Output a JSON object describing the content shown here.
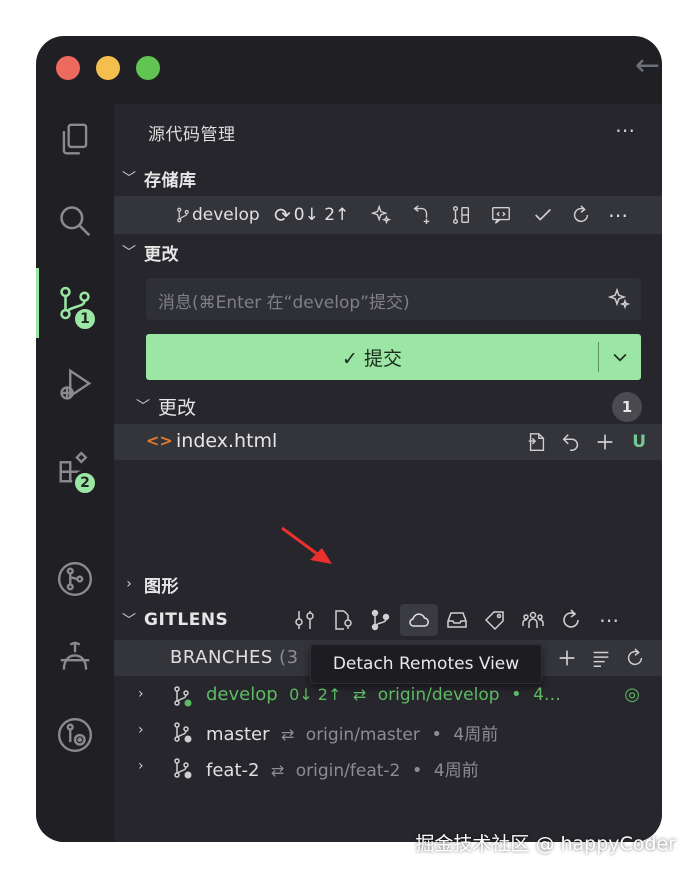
{
  "sidebar": {
    "title": "源代码管理",
    "repositories_label": "存储库",
    "branch": "develop",
    "sync": "0↓ 2↑",
    "changes_label": "更改",
    "commit_placeholder": "消息(⌘Enter 在“develop”提交)",
    "commit_label": "✓ 提交",
    "changes_sub_label": "更改",
    "changes_count": "1",
    "file_icon": "<>",
    "file_name": "index.html",
    "file_status": "U",
    "graph_label": "图形",
    "gitlens_label": "GITLENS",
    "branches_label": "BRANCHES",
    "branches_count_partial": "(3",
    "tooltip": "Detach Remotes View"
  },
  "activity": {
    "scm_badge": "1",
    "extensions_badge": "2"
  },
  "branches": [
    {
      "name": "develop",
      "sync": "0↓ 2↑",
      "arrow": "⇄",
      "remote": "origin/develop",
      "dot": "•",
      "age": "4…"
    },
    {
      "name": "master",
      "sync": "",
      "arrow": "⇄",
      "remote": "origin/master",
      "dot": "•",
      "age": "4周前"
    },
    {
      "name": "feat-2",
      "sync": "",
      "arrow": "⇄",
      "remote": "origin/feat-2",
      "dot": "•",
      "age": "4周前"
    }
  ],
  "watermark": "掘金技术社区 @ happyCoder",
  "colors": {
    "accent": "#9be6a4",
    "window_bg": "#1f1f24",
    "sidebar_bg": "#26262c",
    "branch_current": "#5dbb63",
    "file_icon": "#e37933",
    "untracked": "#73c991",
    "annotation_arrow": "#e8302c"
  },
  "icons": {
    "activity": [
      "explorer-icon",
      "search-icon",
      "source-control-icon",
      "run-debug-icon",
      "extensions-icon",
      "gitlens-icon",
      "gitlens-inspect-icon",
      "gitlens-remote-icon"
    ],
    "repo_toolbar": [
      "sparkle-icon",
      "pull-request-icon",
      "compare-icon",
      "comment-icon",
      "check-icon",
      "refresh-icon",
      "more-icon"
    ],
    "gitlens_toolbar": [
      "commits-icon",
      "file-history-icon",
      "branches-icon",
      "remotes-cloud-icon",
      "stashes-icon",
      "tags-icon",
      "contributors-icon",
      "refresh-icon",
      "more-icon"
    ]
  }
}
